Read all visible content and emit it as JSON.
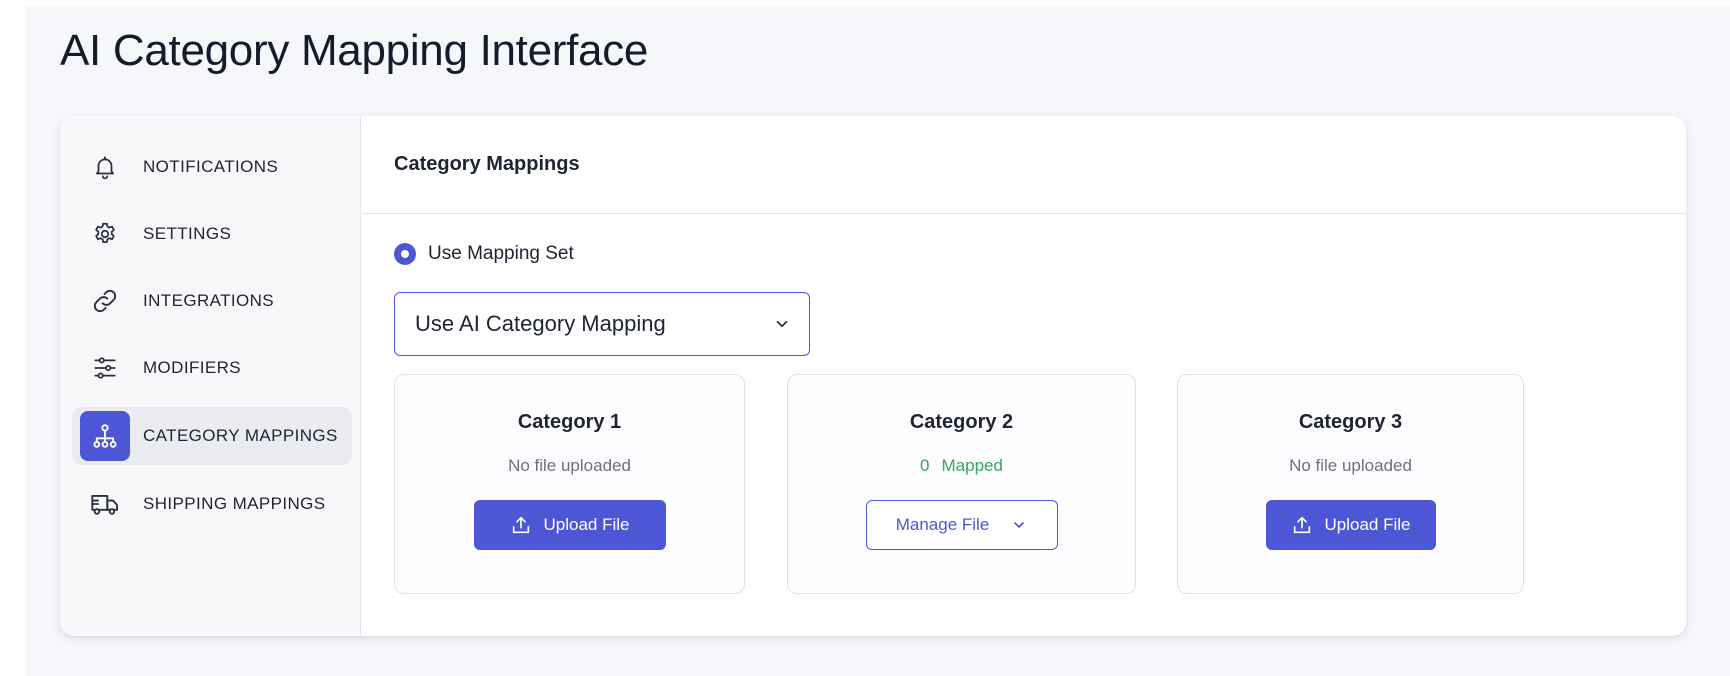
{
  "page": {
    "title": "AI Category Mapping Interface"
  },
  "sidebar": {
    "items": [
      {
        "label": "NOTIFICATIONS",
        "icon": "bell-icon",
        "active": false
      },
      {
        "label": "SETTINGS",
        "icon": "gear-icon",
        "active": false
      },
      {
        "label": "INTEGRATIONS",
        "icon": "link-icon",
        "active": false
      },
      {
        "label": "MODIFIERS",
        "icon": "sliders-icon",
        "active": false
      },
      {
        "label": "CATEGORY MAPPINGS",
        "icon": "hierarchy-icon",
        "active": true
      },
      {
        "label": "SHIPPING MAPPINGS",
        "icon": "truck-icon",
        "active": false
      }
    ]
  },
  "main": {
    "section_title": "Category Mappings",
    "radio_label": "Use Mapping Set",
    "select_value": "Use AI Category Mapping",
    "categories": [
      {
        "title": "Category 1",
        "status": "No file uploaded",
        "button": "Upload File"
      },
      {
        "title": "Category 2",
        "mapped_count": "0",
        "status": "Mapped",
        "button": "Manage File"
      },
      {
        "title": "Category 3",
        "status": "No file uploaded",
        "button": "Upload File"
      }
    ]
  },
  "colors": {
    "accent": "#4d57d6",
    "mapped": "#3aa35f",
    "muted": "#6b7180"
  }
}
